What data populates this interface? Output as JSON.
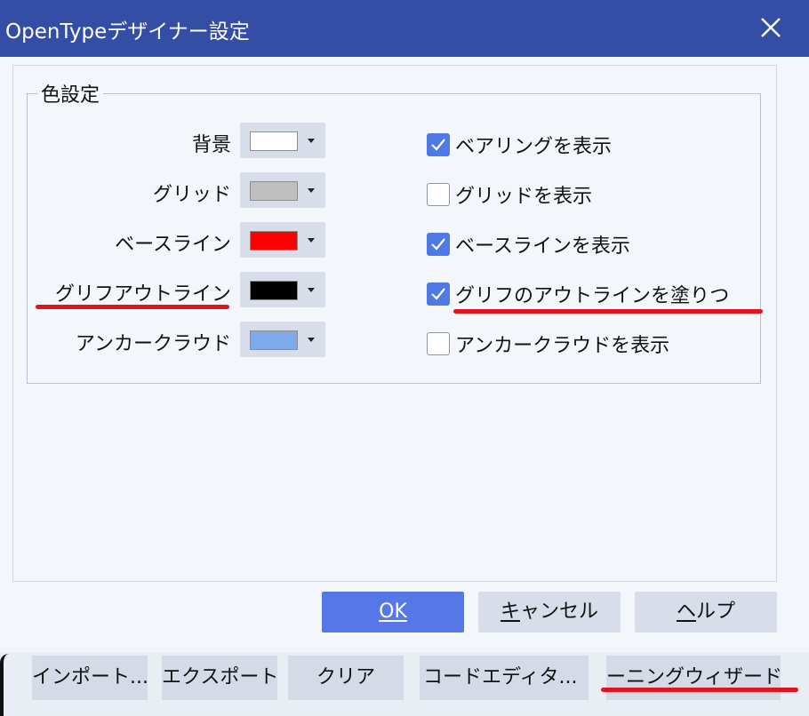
{
  "window": {
    "title": "OpenTypeデザイナー設定"
  },
  "color_group": {
    "legend": "色設定",
    "rows": [
      {
        "label": "背景",
        "color": "#ffffff"
      },
      {
        "label": "グリッド",
        "color": "#bfbfbf"
      },
      {
        "label": "ベースライン",
        "color": "#ff0000"
      },
      {
        "label": "グリフアウトライン",
        "color": "#000000"
      },
      {
        "label": "アンカークラウド",
        "color": "#7ea9eb"
      }
    ],
    "checkboxes": [
      {
        "label": "ベアリングを表示",
        "checked": true
      },
      {
        "label": "グリッドを表示",
        "checked": false
      },
      {
        "label": "ベースラインを表示",
        "checked": true
      },
      {
        "label": "グリフのアウトラインを塗りつ",
        "checked": true
      },
      {
        "label": "アンカークラウドを表示",
        "checked": false
      }
    ]
  },
  "buttons": {
    "ok": "OK",
    "cancel_pre": "キ",
    "cancel_rest": "ャンセル",
    "help_pre": "ヘ",
    "help_rest": "ルプ"
  },
  "background_buttons": {
    "import": "インポート...",
    "export": "エクスポート",
    "clear": "クリア",
    "code_editor": "コードエディタ...",
    "kerning": "ーニングウィザード"
  },
  "annotation_colors": {
    "underline": "#e3141f",
    "accent": "#344ea6"
  }
}
